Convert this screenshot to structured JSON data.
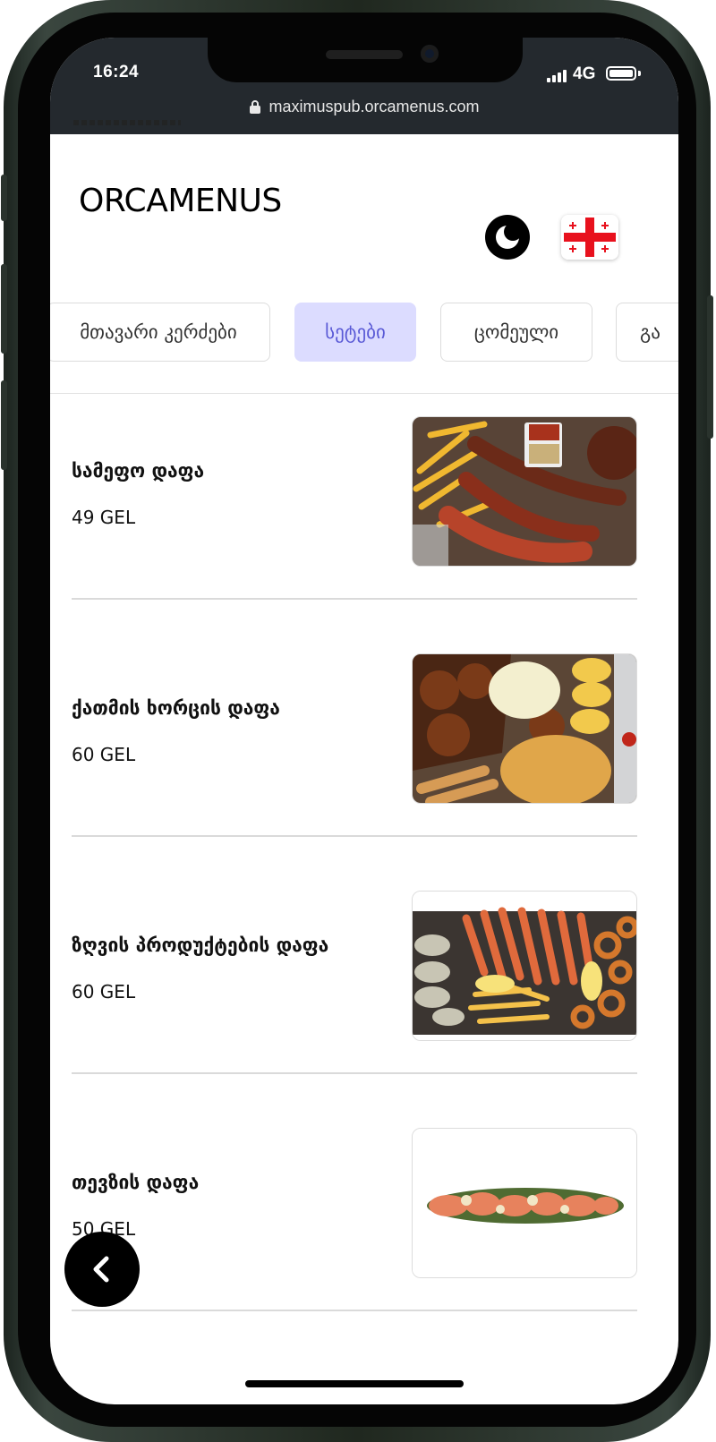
{
  "status_bar": {
    "time": "16:24",
    "network": "4G"
  },
  "browser": {
    "url": "maximuspub.orcamenus.com"
  },
  "header": {
    "logo": "ORCAMENUS",
    "theme_icon": "moon-icon",
    "language_flag": "georgia-flag-icon"
  },
  "tabs": [
    {
      "label": "მთავარი კერძები",
      "active": false
    },
    {
      "label": "სეტები",
      "active": true
    },
    {
      "label": "ცომეული",
      "active": false
    },
    {
      "label": "გა",
      "active": false
    }
  ],
  "items": [
    {
      "name": "სამეფო დაფა",
      "price": "49 GEL",
      "image": "sausage-platter-photo"
    },
    {
      "name": "ქათმის ხორცის დაფა",
      "price": "60 GEL",
      "image": "chicken-platter-photo"
    },
    {
      "name": "ზღვის პროდუქტების დაფა",
      "price": "60 GEL",
      "image": "seafood-platter-photo"
    },
    {
      "name": "თევზის დაფა",
      "price": "50 GEL",
      "image": "fish-platter-photo"
    }
  ],
  "colors": {
    "accent_tab_bg": "#dcdcff",
    "accent_tab_text": "#5a5ad6",
    "status_bar_bg": "#24292e"
  }
}
